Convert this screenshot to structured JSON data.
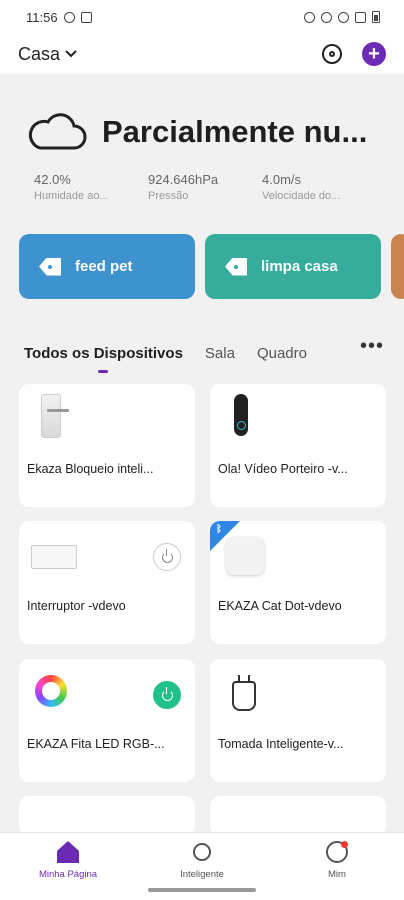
{
  "status_bar": {
    "time": "11:56"
  },
  "header": {
    "home_name": "Casa"
  },
  "weather": {
    "condition": "Parcialmente nu...",
    "stats": [
      {
        "value": "42.0%",
        "label": "Humidade ao..."
      },
      {
        "value": "924.646hPa",
        "label": "Pressão"
      },
      {
        "value": "4.0m/s",
        "label": "Velocidade do..."
      }
    ]
  },
  "scenes": [
    {
      "label": "feed pet",
      "color": "#3e92cd"
    },
    {
      "label": "limpa casa",
      "color": "#35ac9c"
    }
  ],
  "tabs": [
    "Todos os Dispositivos",
    "Sala",
    "Quadro"
  ],
  "devices": [
    {
      "name": "Ekaza Bloqueio inteli...",
      "icon": "smart-lock-icon"
    },
    {
      "name": "Ola! Vídeo Porteiro -v...",
      "icon": "video-doorbell-icon"
    },
    {
      "name": "Interruptor -vdevo",
      "icon": "switch-icon",
      "power": "off"
    },
    {
      "name": "EKAZA Cat Dot-vdevo",
      "icon": "cat-dot-icon",
      "bluetooth": true
    },
    {
      "name": "EKAZA Fita LED RGB-...",
      "icon": "led-ring-icon",
      "power": "on"
    },
    {
      "name": "Tomada Inteligente-v...",
      "icon": "plug-icon"
    }
  ],
  "bottom_nav": [
    {
      "label": "Minha Página",
      "icon": "home-icon",
      "active": true
    },
    {
      "label": "Inteligente",
      "icon": "sun-icon"
    },
    {
      "label": "Mim",
      "icon": "user-icon"
    }
  ],
  "colors": {
    "accent": "#6c2bb5",
    "power_on": "#1fc18d"
  }
}
